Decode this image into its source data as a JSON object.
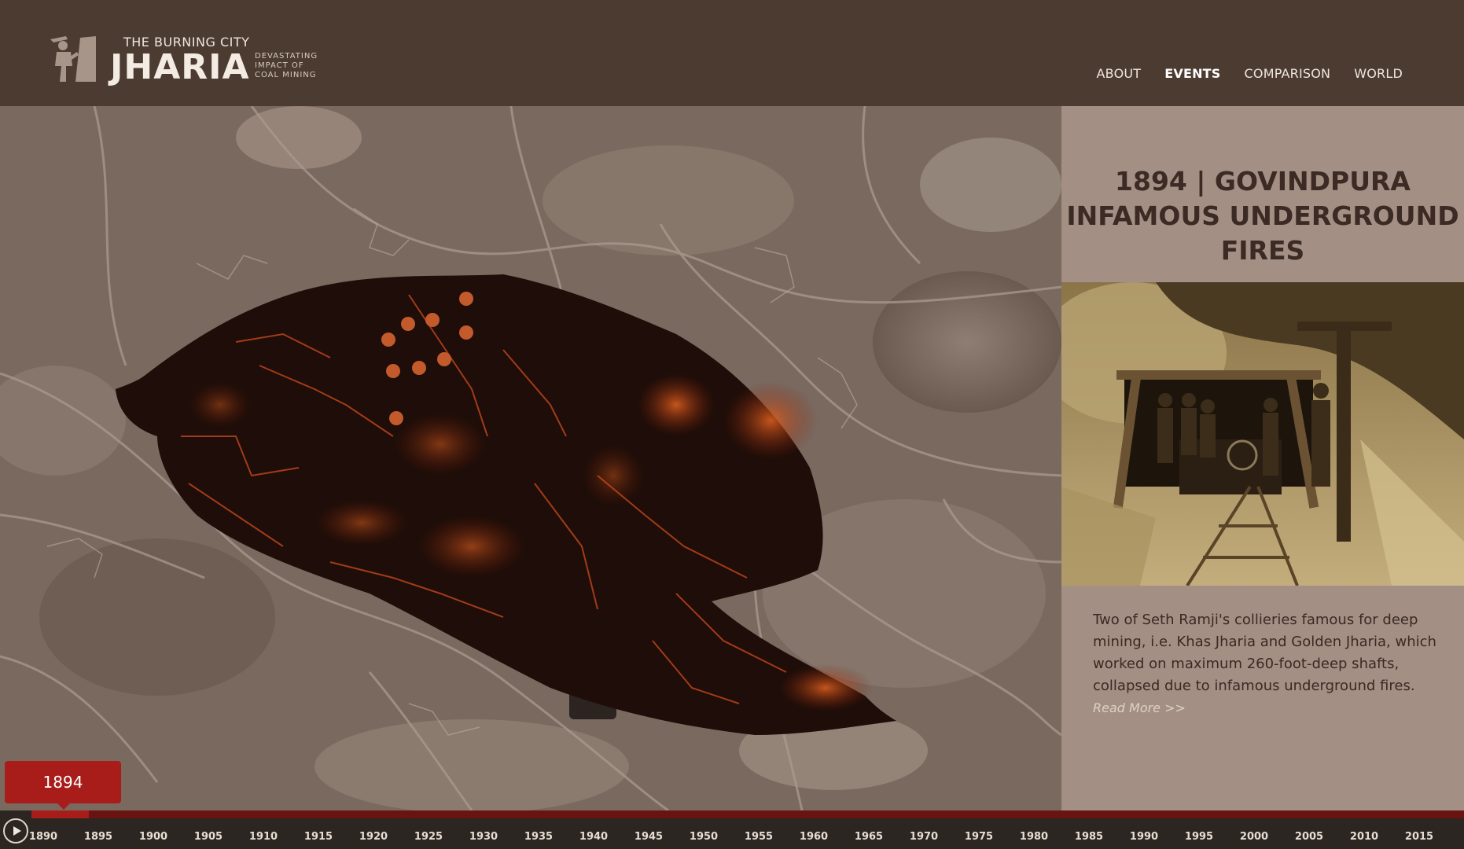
{
  "brand": {
    "top_line": "THE BURNING CITY",
    "name": "JHARIA",
    "tagline": [
      "DEVASTATING",
      "IMPACT OF",
      "COAL MINING"
    ],
    "icon": "miner-logo-icon"
  },
  "nav": {
    "items": [
      "ABOUT",
      "EVENTS",
      "COMPARISON",
      "WORLD"
    ],
    "active": "EVENTS"
  },
  "event": {
    "title_line1": "1894 | GOVINDPURA",
    "title_line2": "INFAMOUS UNDERGROUND",
    "title_line3": "FIRES",
    "description": "Two of Seth Ramji's collieries famous for deep mining, i.e. Khas Jharia and Golden Jharia, which worked on maximum 260-foot-deep shafts, collapsed due to infamous underground fires.",
    "read_more": "Read More >>"
  },
  "timeline": {
    "selected_year": "1894",
    "years": [
      "1890",
      "1895",
      "1900",
      "1905",
      "1910",
      "1915",
      "1920",
      "1925",
      "1930",
      "1935",
      "1940",
      "1945",
      "1950",
      "1955",
      "1960",
      "1965",
      "1970",
      "1975",
      "1980",
      "1985",
      "1990",
      "1995",
      "2000",
      "2005",
      "2010",
      "2015"
    ],
    "progress_fraction": 0.04
  },
  "colors": {
    "header_bg": "#4b3b31",
    "panel_bg": "#a48f84",
    "accent_red": "#a81d1a",
    "fire_orange": "#d9622c"
  }
}
